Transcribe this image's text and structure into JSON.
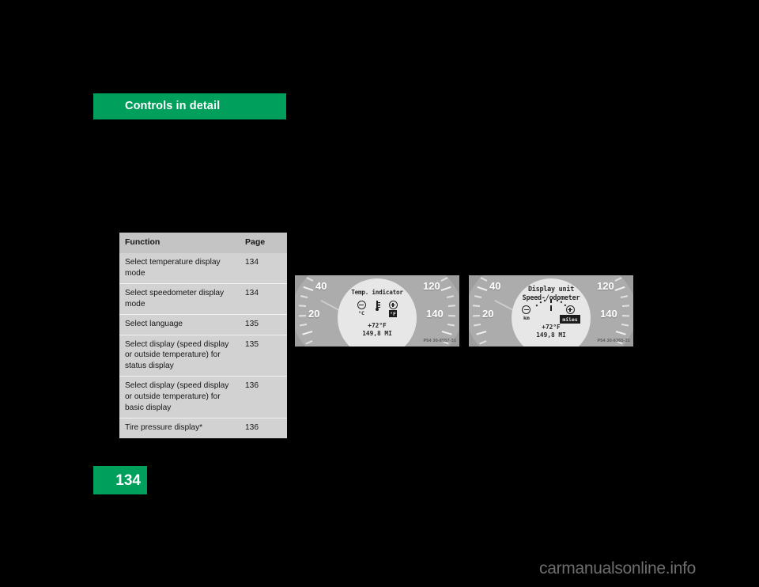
{
  "header": {
    "title": "Controls in detail",
    "accent_color": "#00A05C"
  },
  "table": {
    "columns": [
      "Function",
      "Page"
    ],
    "rows": [
      {
        "function": "Select temperature display mode",
        "page": "134"
      },
      {
        "function": "Select speedometer display mode",
        "page": "134"
      },
      {
        "function": "Select language",
        "page": "135"
      },
      {
        "function": "Select display (speed display or outside temperature) for status display",
        "page": "135"
      },
      {
        "function": "Select display (speed display or outside temperature) for basic display",
        "page": "136"
      },
      {
        "function": "Tire pressure display*",
        "page": "136"
      }
    ]
  },
  "figures": {
    "left": {
      "title": "Temp. indicator",
      "icons": [
        {
          "name": "minus-circle",
          "caption": "°C",
          "highlighted": false
        },
        {
          "name": "thermometer",
          "caption": "",
          "highlighted": false
        },
        {
          "name": "plus-circle",
          "caption": "°F",
          "highlighted": true
        }
      ],
      "readout_line1": "+72°F",
      "readout_line2": "149,8 MI",
      "dial_numbers": [
        "40",
        "20",
        "120",
        "140"
      ],
      "code": "P54 30-6557-31"
    },
    "right": {
      "title_line1": "Display unit",
      "title_line2": "Speed-/odometer",
      "icons": [
        {
          "name": "minus-circle",
          "caption": "km",
          "highlighted": false
        },
        {
          "name": "plus-circle",
          "caption": "miles",
          "highlighted": true
        }
      ],
      "readout_line1": "+72°F",
      "readout_line2": "149,8 MI",
      "dial_numbers": [
        "40",
        "20",
        "120",
        "140"
      ],
      "code": "P54 30-6265-31"
    }
  },
  "footer": {
    "page_number": "134",
    "watermark": "carmanualsonline.info"
  }
}
